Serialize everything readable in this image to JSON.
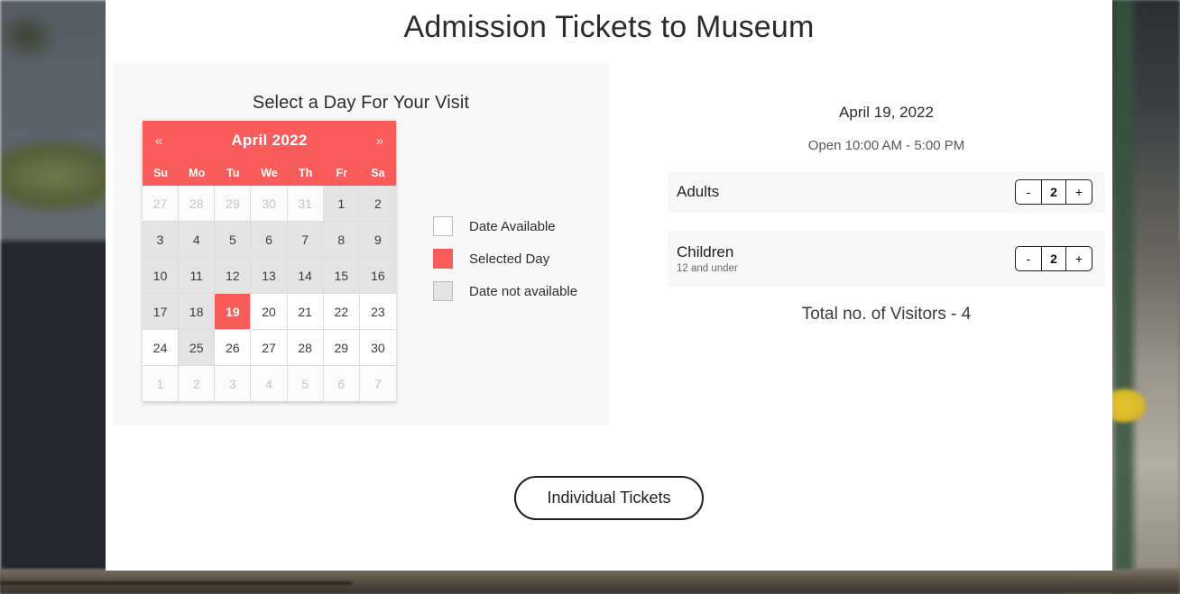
{
  "page": {
    "title": "Admission Tickets to Museum"
  },
  "left": {
    "heading": "Select a Day For Your Visit",
    "calendar": {
      "prev_label": "«",
      "next_label": "»",
      "month_title": "April 2022",
      "dow": [
        "Su",
        "Mo",
        "Tu",
        "We",
        "Th",
        "Fr",
        "Sa"
      ],
      "selected_day": 19,
      "cells": [
        {
          "d": "27",
          "state": "muted"
        },
        {
          "d": "28",
          "state": "muted"
        },
        {
          "d": "29",
          "state": "muted"
        },
        {
          "d": "30",
          "state": "muted"
        },
        {
          "d": "31",
          "state": "muted"
        },
        {
          "d": "1",
          "state": "unavailable"
        },
        {
          "d": "2",
          "state": "unavailable"
        },
        {
          "d": "3",
          "state": "unavailable"
        },
        {
          "d": "4",
          "state": "unavailable"
        },
        {
          "d": "5",
          "state": "unavailable"
        },
        {
          "d": "6",
          "state": "unavailable"
        },
        {
          "d": "7",
          "state": "unavailable"
        },
        {
          "d": "8",
          "state": "unavailable"
        },
        {
          "d": "9",
          "state": "unavailable"
        },
        {
          "d": "10",
          "state": "unavailable"
        },
        {
          "d": "11",
          "state": "unavailable"
        },
        {
          "d": "12",
          "state": "unavailable"
        },
        {
          "d": "13",
          "state": "unavailable"
        },
        {
          "d": "14",
          "state": "unavailable"
        },
        {
          "d": "15",
          "state": "unavailable"
        },
        {
          "d": "16",
          "state": "unavailable"
        },
        {
          "d": "17",
          "state": "unavailable"
        },
        {
          "d": "18",
          "state": "unavailable"
        },
        {
          "d": "19",
          "state": "selected"
        },
        {
          "d": "20",
          "state": "available"
        },
        {
          "d": "21",
          "state": "available"
        },
        {
          "d": "22",
          "state": "available"
        },
        {
          "d": "23",
          "state": "available"
        },
        {
          "d": "24",
          "state": "available"
        },
        {
          "d": "25",
          "state": "unavailable"
        },
        {
          "d": "26",
          "state": "available"
        },
        {
          "d": "27",
          "state": "available"
        },
        {
          "d": "28",
          "state": "available"
        },
        {
          "d": "29",
          "state": "available"
        },
        {
          "d": "30",
          "state": "available"
        },
        {
          "d": "1",
          "state": "muted"
        },
        {
          "d": "2",
          "state": "muted"
        },
        {
          "d": "3",
          "state": "muted"
        },
        {
          "d": "4",
          "state": "muted"
        },
        {
          "d": "5",
          "state": "muted"
        },
        {
          "d": "6",
          "state": "muted"
        },
        {
          "d": "7",
          "state": "muted"
        }
      ]
    },
    "legend": [
      {
        "label": "Date Available",
        "swatch": "avail",
        "color": "#ffffff"
      },
      {
        "label": "Selected Day",
        "swatch": "selected",
        "color": "#fa5c5c"
      },
      {
        "label": "Date not available",
        "swatch": "notavail",
        "color": "#e4e4e4"
      }
    ]
  },
  "right": {
    "selected_date": "April 19, 2022",
    "open_hours": "Open 10:00 AM - 5:00 PM",
    "tickets": [
      {
        "name": "Adults",
        "sub": "",
        "minus": "-",
        "value": "2",
        "plus": "+"
      },
      {
        "name": "Children",
        "sub": "12 and under",
        "minus": "-",
        "value": "2",
        "plus": "+"
      }
    ],
    "total_text": "Total no. of Visitors - 4"
  },
  "footer": {
    "button_label": "Individual Tickets"
  },
  "colors": {
    "accent_red": "#fa5c5c",
    "panel_gray": "#f8f8f8",
    "unavailable_gray": "#e4e4e4",
    "card_white": "#ffffff"
  }
}
